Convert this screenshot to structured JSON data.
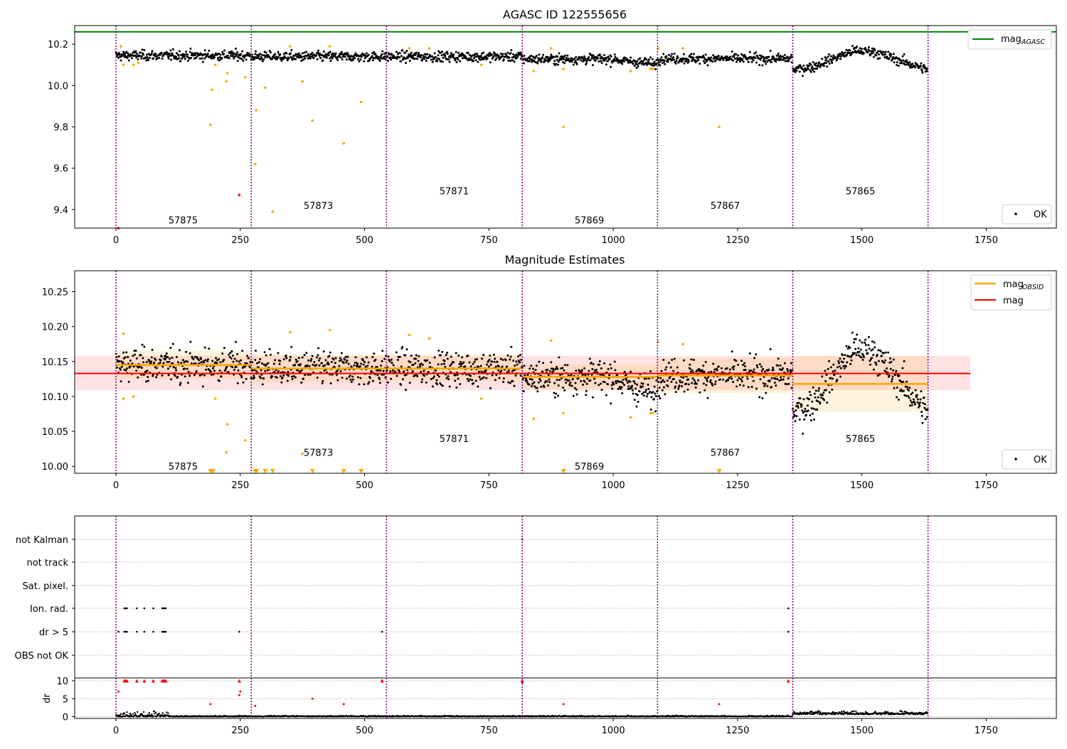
{
  "x_tick_labels": [
    "0",
    "250",
    "500",
    "750",
    "1000",
    "1250",
    "1500",
    "1750"
  ],
  "colors": {
    "ok": "#000000",
    "outlier": "#ffa500",
    "bad": "#ff0000",
    "agasc_line": "#008000",
    "obs_line": "#ffa500",
    "mag_line": "#ff0000",
    "boundary": "#800080"
  },
  "obsids": [
    "57875",
    "57873",
    "57871",
    "57869",
    "57867",
    "57865"
  ],
  "chart_data": [
    {
      "type": "scatter",
      "title": "AGASC ID 122555656",
      "xlim": [
        -83,
        1891
      ],
      "ylim": [
        9.31,
        10.29
      ],
      "yticks": [
        "9.4",
        "9.6",
        "9.8",
        "10.0",
        "10.2"
      ],
      "mag_agasc": 10.26,
      "legend": {
        "line_label": "mag",
        "line_sub": "AGASC",
        "points_label": "OK",
        "placement": "upper-right / lower-right"
      },
      "obs_boundaries": [
        0,
        272,
        544,
        817,
        1089,
        1361,
        1633
      ],
      "obs_means": [
        10.145,
        10.14,
        10.14,
        10.128,
        10.13,
        10.118
      ],
      "outliers": [
        [
          10,
          10.19
        ],
        [
          15,
          10.1
        ],
        [
          35,
          10.1
        ],
        [
          45,
          10.11
        ],
        [
          190,
          9.81
        ],
        [
          193,
          9.98
        ],
        [
          200,
          10.1
        ],
        [
          222,
          10.02
        ],
        [
          224,
          10.06
        ],
        [
          260,
          10.04
        ],
        [
          280,
          9.62
        ],
        [
          282,
          9.88
        ],
        [
          300,
          9.99
        ],
        [
          315,
          9.39
        ],
        [
          350,
          10.19
        ],
        [
          375,
          10.02
        ],
        [
          395,
          9.83
        ],
        [
          430,
          10.19
        ],
        [
          458,
          9.72
        ],
        [
          493,
          9.92
        ],
        [
          590,
          10.18
        ],
        [
          630,
          10.18
        ],
        [
          735,
          10.1
        ],
        [
          840,
          10.07
        ],
        [
          875,
          10.18
        ],
        [
          900,
          10.08
        ],
        [
          900,
          9.8
        ],
        [
          1035,
          10.07
        ],
        [
          1075,
          10.08
        ],
        [
          1080,
          10.08
        ],
        [
          1090,
          10.18
        ],
        [
          1140,
          10.18
        ],
        [
          1213,
          9.8
        ]
      ],
      "bad_points": [
        [
          248,
          9.47
        ],
        [
          5,
          9.31
        ]
      ],
      "obsid_labels": [
        [
          135,
          9.35
        ],
        [
          407,
          9.42
        ],
        [
          680,
          9.49
        ],
        [
          952,
          9.35
        ],
        [
          1225,
          9.42
        ],
        [
          1497,
          9.49
        ]
      ]
    },
    {
      "type": "scatter",
      "title": "Magnitude Estimates",
      "xlim": [
        -83,
        1891
      ],
      "ylim": [
        9.99,
        10.28
      ],
      "yticks": [
        "10.00",
        "10.05",
        "10.10",
        "10.15",
        "10.20",
        "10.25"
      ],
      "mag": 10.133,
      "mag_band": [
        10.109,
        10.158
      ],
      "mag_band_x": [
        -83,
        1718
      ],
      "obs_bands": [
        [
          10.125,
          10.165
        ],
        [
          10.12,
          10.16
        ],
        [
          10.122,
          10.16
        ],
        [
          10.11,
          10.146
        ],
        [
          10.105,
          10.155
        ],
        [
          10.078,
          10.158
        ]
      ],
      "legend": {
        "obs_label": "mag",
        "obs_sub": "OBSID",
        "mag_label": "mag",
        "points_label": "OK",
        "placement": "upper-right / lower-right"
      },
      "obs_boundaries": [
        0,
        272,
        544,
        817,
        1089,
        1361,
        1633
      ],
      "obs_means": [
        10.145,
        10.14,
        10.14,
        10.128,
        10.13,
        10.118
      ],
      "outliers": [
        [
          15,
          10.19
        ],
        [
          15,
          10.097
        ],
        [
          35,
          10.1
        ],
        [
          200,
          10.097
        ],
        [
          222,
          10.02
        ],
        [
          224,
          10.06
        ],
        [
          260,
          10.037
        ],
        [
          350,
          10.192
        ],
        [
          375,
          10.018
        ],
        [
          430,
          10.195
        ],
        [
          590,
          10.188
        ],
        [
          630,
          10.183
        ],
        [
          735,
          10.097
        ],
        [
          840,
          10.068
        ],
        [
          875,
          10.18
        ],
        [
          900,
          10.076
        ],
        [
          1035,
          10.07
        ],
        [
          1075,
          10.076
        ],
        [
          1080,
          10.076
        ],
        [
          1090,
          10.178
        ],
        [
          1140,
          10.175
        ]
      ],
      "below_markers": [
        190,
        195,
        280,
        283,
        300,
        315,
        395,
        458,
        493,
        900,
        1213
      ],
      "obsid_labels": [
        [
          135,
          10.0
        ],
        [
          407,
          10.02
        ],
        [
          680,
          10.04
        ],
        [
          952,
          10.0
        ],
        [
          1225,
          10.02
        ],
        [
          1497,
          10.04
        ]
      ]
    },
    {
      "type": "scatter",
      "title": "",
      "xlim": [
        -83,
        1891
      ],
      "flag_labels": [
        "not Kalman",
        "not track",
        "Sat. pixel.",
        "Ion. rad.",
        "dr > 5",
        "OBS not OK"
      ],
      "flag_points": {
        "Ion. rad.": [
          17,
          19,
          22,
          42,
          57,
          75,
          93,
          96,
          98,
          100,
          1352
        ],
        "dr > 5": [
          5,
          17,
          19,
          22,
          42,
          57,
          75,
          93,
          96,
          98,
          100,
          248,
          535,
          1352
        ],
        "not Kalman": [
          817
        ]
      },
      "dr_ylabel": "dr",
      "dr_ylim": [
        -0.5,
        10.8
      ],
      "dr_yticks": [
        "0",
        "5",
        "10"
      ],
      "dr_capped": [
        17,
        19,
        22,
        42,
        57,
        75,
        93,
        96,
        98,
        100,
        248,
        535,
        817,
        1352
      ],
      "dr_red": [
        [
          5,
          7
        ],
        [
          190,
          3.5
        ],
        [
          248,
          6
        ],
        [
          250,
          7
        ],
        [
          280,
          3
        ],
        [
          395,
          5
        ],
        [
          458,
          3.5
        ],
        [
          535,
          10
        ],
        [
          817,
          9.5
        ],
        [
          900,
          3.5
        ],
        [
          1213,
          3.5
        ]
      ]
    }
  ]
}
